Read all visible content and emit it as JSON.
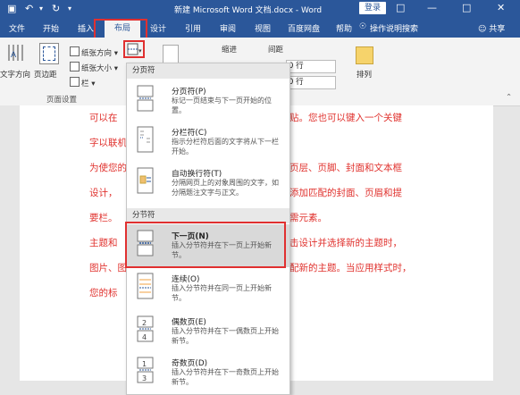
{
  "title_bar": {
    "title": "新建 Microsoft Word 文档.docx - Word",
    "login": "登录"
  },
  "tabs": [
    "文件",
    "开始",
    "插入",
    "布局",
    "设计",
    "引用",
    "审阅",
    "视图",
    "百度网盘",
    "帮助",
    "操作说明搜索"
  ],
  "share": "共享",
  "ribbon": {
    "text_direction": "文字方向",
    "margins": "页边距",
    "orientation": "纸张方向",
    "size": "纸张大小",
    "columns": "栏",
    "group_page_setup": "页面设置",
    "indent": "缩进",
    "spacing": "间距",
    "spacing_before": "0 行",
    "spacing_after": "0 行",
    "arrange": "排列"
  },
  "menu": {
    "section_page": "分页符",
    "section_section": "分节符",
    "items": [
      {
        "title": "分页符(P)",
        "desc": "标记一页结束与下一页开始的位置。"
      },
      {
        "title": "分栏符(C)",
        "desc": "指示分栏符后面的文字将从下一栏开始。"
      },
      {
        "title": "自动换行符(T)",
        "desc": "分隔网页上的对象周围的文字，如分隔题注文字与正文。"
      },
      {
        "title": "下一页(N)",
        "desc": "插入分节符并在下一页上开始新节。"
      },
      {
        "title": "连续(O)",
        "desc": "插入分节符并在同一页上开始新节。"
      },
      {
        "title": "偶数页(E)",
        "desc": "插入分节符并在下一偶数页上开始新节。"
      },
      {
        "title": "奇数页(D)",
        "desc": "插入分节符并在下一奇数页上开始新节。"
      }
    ]
  },
  "document": {
    "lines": [
      {
        "left": "可以在",
        "right": "贴。您也可以键入一个关键"
      },
      {
        "left": "字以联机",
        "right": ""
      },
      {
        "left": "为使您的",
        "right": "页层、页脚、封面和文本框"
      },
      {
        "left": "设计，",
        "right": "添加匹配的封面、页眉和提"
      },
      {
        "left": "要栏。",
        "right": "需元素。"
      },
      {
        "left": "主题和",
        "right": "击设计并选择新的主题时，"
      },
      {
        "left": "图片、图",
        "right": "配新的主题。当应用样式时，"
      },
      {
        "left": "您的标",
        "right": ""
      }
    ]
  },
  "colors": {
    "ribbon_blue": "#2b579a",
    "highlight_red": "#e03030",
    "doc_text_red": "#e0322e"
  }
}
